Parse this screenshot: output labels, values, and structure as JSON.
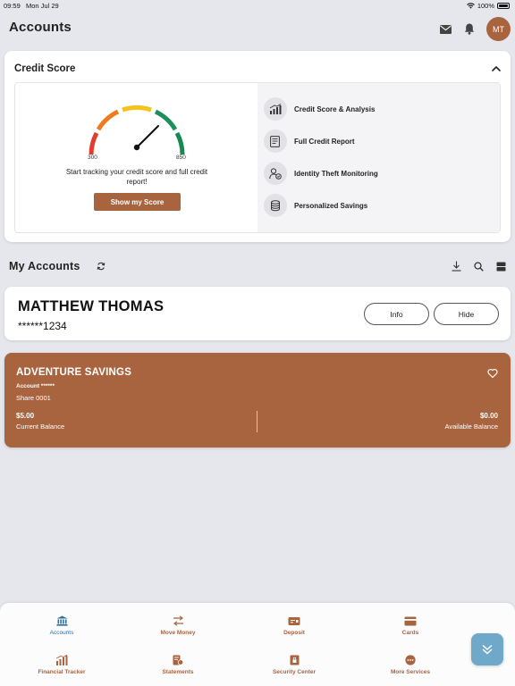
{
  "status_bar": {
    "time": "09:59",
    "date": "Mon Jul 29",
    "battery": "100%"
  },
  "header": {
    "title": "Accounts",
    "avatar_initials": "MT"
  },
  "credit_score": {
    "title": "Credit Score",
    "gauge_min": "300",
    "gauge_max": "850",
    "description": "Start tracking your credit score and full credit report!",
    "button_label": "Show my Score",
    "features": [
      {
        "label": "Credit Score & Analysis",
        "icon": "chart-icon"
      },
      {
        "label": "Full Credit Report",
        "icon": "report-icon"
      },
      {
        "label": "Identity Theft Monitoring",
        "icon": "identity-icon"
      },
      {
        "label": "Personalized Savings",
        "icon": "savings-icon"
      }
    ]
  },
  "my_accounts": {
    "title": "My Accounts",
    "member": {
      "name": "MATTHEW THOMAS",
      "number": "******1234",
      "info_label": "Info",
      "hide_label": "Hide"
    },
    "accounts": [
      {
        "name": "ADVENTURE SAVINGS",
        "account_label": "Account ******",
        "share": "Share 0001",
        "current_balance": "$5.00",
        "current_balance_label": "Current Balance",
        "available_balance": "$0.00",
        "available_balance_label": "Available Balance"
      }
    ]
  },
  "bottom_nav": {
    "items": [
      {
        "label": "Accounts",
        "icon": "bank-icon",
        "active": true
      },
      {
        "label": "Move Money",
        "icon": "transfer-icon"
      },
      {
        "label": "Deposit",
        "icon": "deposit-icon"
      },
      {
        "label": "Cards",
        "icon": "card-icon"
      },
      {
        "label": "Financial Tracker",
        "icon": "tracker-icon"
      },
      {
        "label": "Statements",
        "icon": "statements-icon"
      },
      {
        "label": "Security Center",
        "icon": "security-icon"
      },
      {
        "label": "More Services",
        "icon": "more-icon"
      }
    ]
  },
  "colors": {
    "brand": "#a8643f",
    "active_nav": "#2f6ea0",
    "fab": "#6fa8c9",
    "background": "#e6e7ec"
  }
}
